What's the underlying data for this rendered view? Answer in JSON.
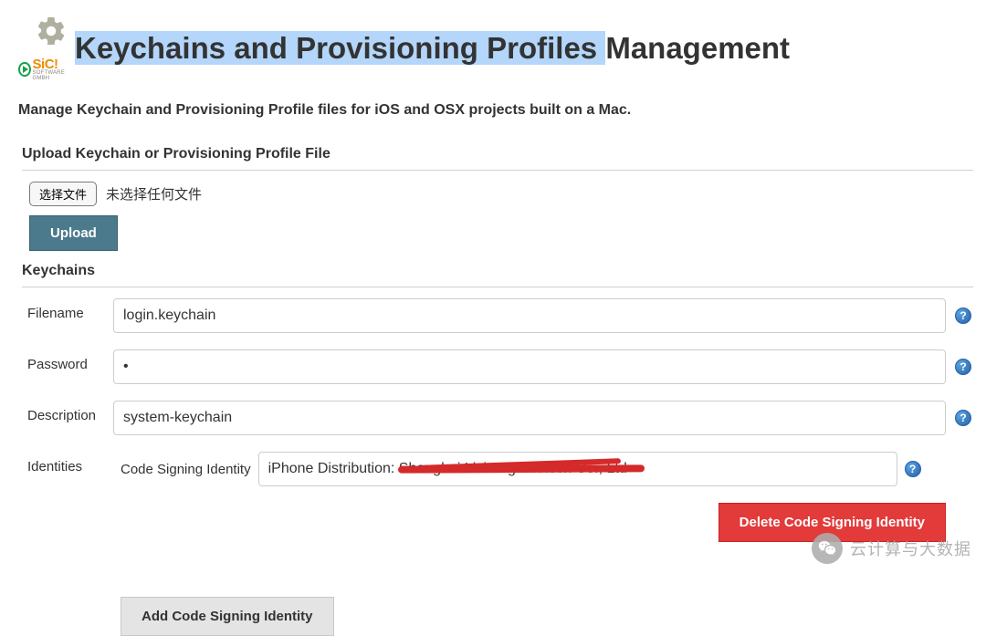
{
  "header": {
    "title_highlighted": "Keychains and Provisioning Profiles ",
    "title_rest": "Management",
    "brand": "SiC!",
    "brand_sub": "SOFTWARE GMBH"
  },
  "subtitle": "Manage Keychain and Provisioning Profile files for iOS and OSX projects built on a Mac.",
  "upload": {
    "section_title": "Upload Keychain or Provisioning Profile File",
    "choose_label": "选择文件",
    "file_status": "未选择任何文件",
    "upload_btn": "Upload"
  },
  "keychains": {
    "section_title": "Keychains",
    "fields": {
      "filename": {
        "label": "Filename",
        "value": "login.keychain"
      },
      "password": {
        "label": "Password",
        "value": "•"
      },
      "description": {
        "label": "Description",
        "value": "system-keychain"
      }
    },
    "identities": {
      "label": "Identities",
      "csi_label": "Code Signing Identity",
      "csi_value": "iPhone Distribution: Shanghai Licheng Infotech Co., Ltd",
      "delete_btn": "Delete Code Signing Identity",
      "add_btn": "Add Code Signing Identity"
    }
  },
  "help_glyph": "?",
  "watermark": "云计算与大数据"
}
